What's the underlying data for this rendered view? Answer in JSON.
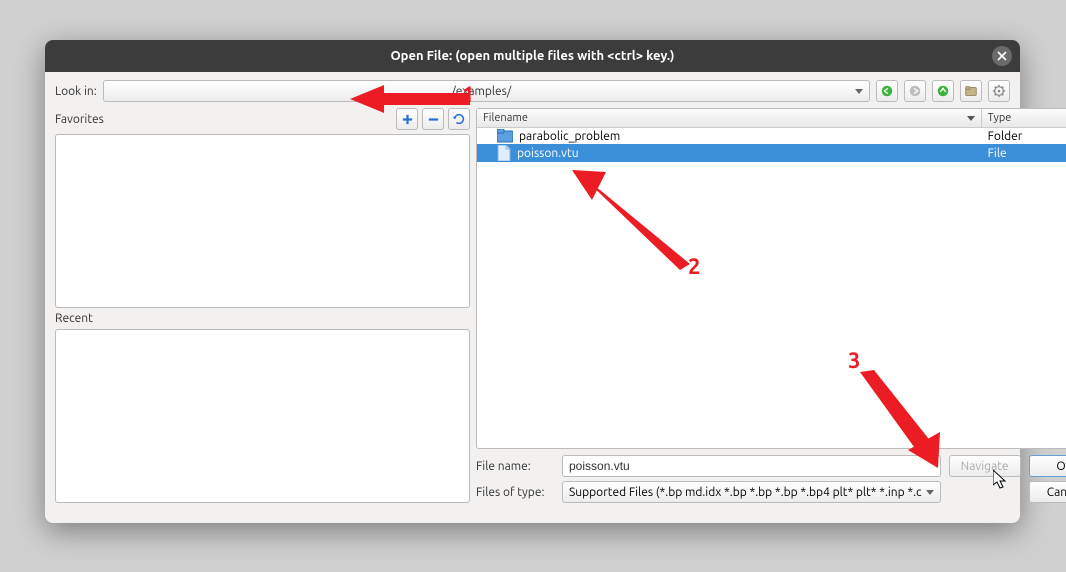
{
  "titlebar": {
    "title": "Open File:  (open multiple files with <ctrl> key.)"
  },
  "lookin": {
    "label": "Look in:",
    "path": "/examples/"
  },
  "favorites": {
    "label": "Favorites"
  },
  "recent": {
    "label": "Recent"
  },
  "table": {
    "col_filename": "Filename",
    "col_type": "Type",
    "rows": [
      {
        "name": "parabolic_problem",
        "type": "Folder",
        "kind": "folder"
      },
      {
        "name": "poisson.vtu",
        "type": "File",
        "kind": "file",
        "selected": true
      }
    ]
  },
  "filename": {
    "label": "File name:",
    "value": "poisson.vtu"
  },
  "filetype": {
    "label": "Files of type:",
    "value": "Supported Files (*.bp md.idx *.bp *.bp *.bp *.bp4 plt* plt* *.inp *.c"
  },
  "buttons": {
    "navigate": "Navigate",
    "ok": "OK",
    "cancel": "Cancel"
  },
  "annotations": {
    "n1": "1",
    "n2": "2",
    "n3": "3"
  },
  "icons": {
    "plus": "plus-icon",
    "minus": "minus-icon",
    "refresh": "refresh-icon",
    "back": "nav-back-icon",
    "forward": "nav-forward-icon",
    "up": "nav-up-icon",
    "newfolder": "newfolder-icon",
    "gear": "gear-icon"
  }
}
